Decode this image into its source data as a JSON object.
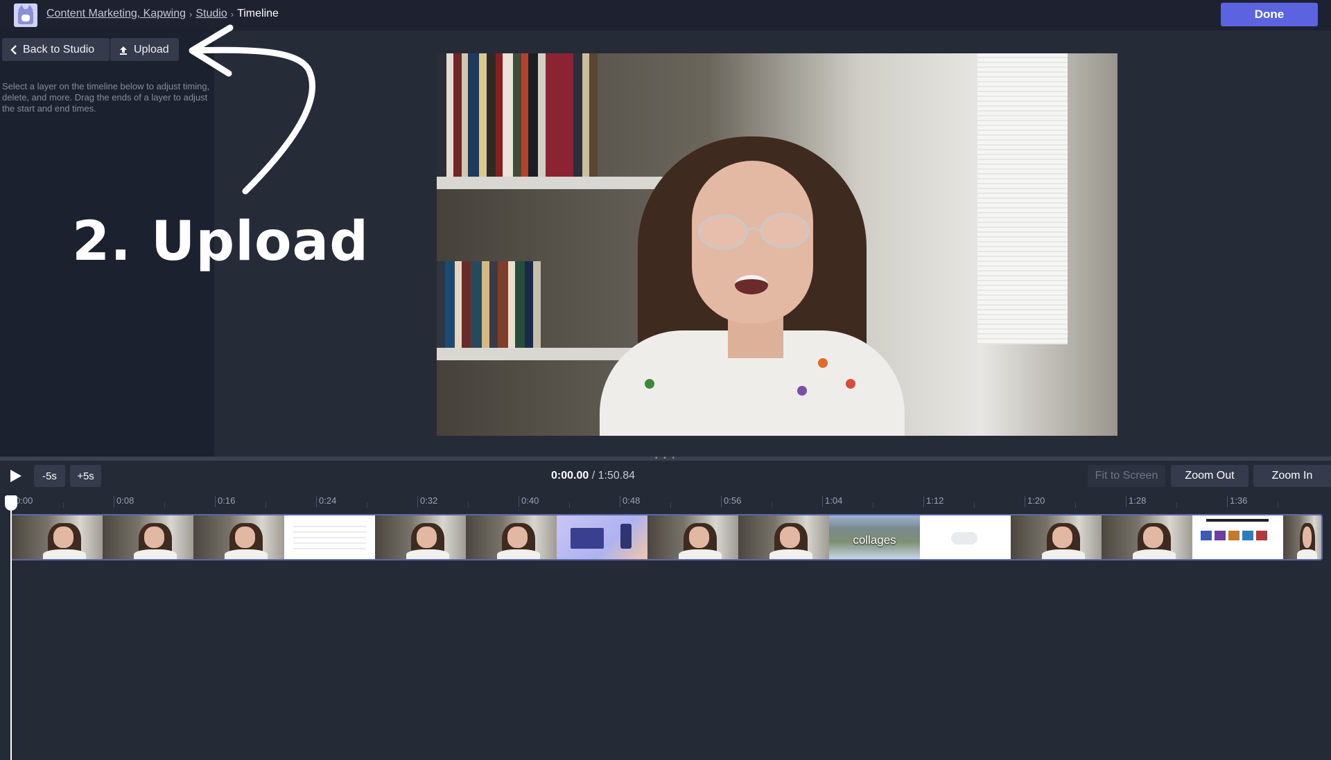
{
  "header": {
    "breadcrumbs": [
      {
        "label": "Content Marketing, Kapwing",
        "link": true
      },
      {
        "label": "Studio",
        "link": true
      },
      {
        "label": "Timeline",
        "link": false
      }
    ],
    "done_label": "Done"
  },
  "sidebar": {
    "back_label": "Back to Studio",
    "upload_label": "Upload",
    "help_text": "Select a layer on the timeline below to adjust timing, delete, and more. Drag the ends of a layer to adjust the start and end times."
  },
  "annotation": {
    "text": "2. Upload"
  },
  "controls": {
    "minus5_label": "-5s",
    "plus5_label": "+5s",
    "current_time": "0:00.00",
    "total_time": " / 1:50.84",
    "fit_label": "Fit to Screen",
    "zoom_out_label": "Zoom Out",
    "zoom_in_label": "Zoom In"
  },
  "timeline": {
    "ticks": [
      "0:00",
      "0:08",
      "0:16",
      "0:24",
      "0:32",
      "0:40",
      "0:48",
      "0:56",
      "1:04",
      "1:12",
      "1:20",
      "1:28",
      "1:36"
    ],
    "clips": [
      {
        "kind": "vid"
      },
      {
        "kind": "vid"
      },
      {
        "kind": "vid"
      },
      {
        "kind": "white-grid"
      },
      {
        "kind": "vid"
      },
      {
        "kind": "vid"
      },
      {
        "kind": "purple"
      },
      {
        "kind": "vid"
      },
      {
        "kind": "vid"
      },
      {
        "kind": "photo",
        "caption": "collages"
      },
      {
        "kind": "white-bubble"
      },
      {
        "kind": "vid"
      },
      {
        "kind": "vid"
      },
      {
        "kind": "white-thumbs"
      },
      {
        "kind": "vid"
      }
    ]
  },
  "colors": {
    "accent": "#5b63e0",
    "track_border": "#5a68a8"
  }
}
